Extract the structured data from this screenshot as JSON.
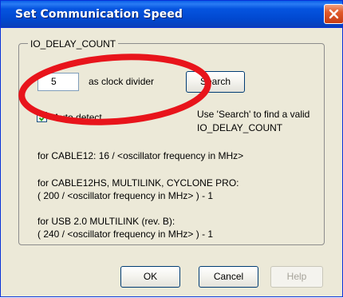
{
  "window": {
    "title": "Set Communication Speed"
  },
  "group": {
    "label": "IO_DELAY_COUNT"
  },
  "divider_input": {
    "value": "5"
  },
  "labels": {
    "clock_divider": "as clock divider",
    "auto_detect": "Auto detect",
    "hint_line1": "Use 'Search' to find a valid",
    "hint_line2": "IO_DELAY_COUNT"
  },
  "buttons": {
    "search": "Search",
    "ok": "OK",
    "cancel": "Cancel",
    "help": "Help"
  },
  "checkbox": {
    "checked": true
  },
  "descriptions": [
    "for CABLE12: 16 / <oscillator frequency in MHz>",
    "for CABLE12HS, MULTILINK, CYCLONE PRO:",
    "( 200 / <oscillator frequency in MHz> ) - 1",
    "for USB 2.0 MULTILINK (rev. B):",
    "( 240 / <oscillator frequency in MHz> ) - 1"
  ],
  "colors": {
    "titlebar": "#0554e0",
    "dialog_bg": "#ece9d8",
    "close_button": "#e05a2a",
    "annotation": "#e8141b"
  },
  "icons": {
    "close": "close-icon",
    "check": "check-icon"
  }
}
